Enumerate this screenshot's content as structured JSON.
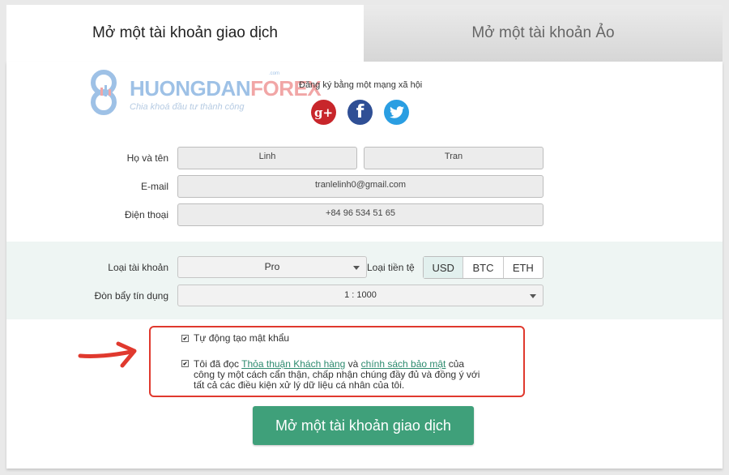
{
  "tabs": {
    "active": "Mở một tài khoản giao dịch",
    "inactive": "Mở một tài khoản Ảo"
  },
  "logo": {
    "name_part1": "HUONGDAN",
    "name_part2": "FOREX",
    "com": ".com",
    "tagline": "Chia khoá đầu tư thành công"
  },
  "social": {
    "label": "Đăng ký bằng một mạng xã hội",
    "icons": [
      "google-plus-icon",
      "facebook-icon",
      "twitter-icon"
    ],
    "google_glyph": "g+",
    "facebook_glyph": "f"
  },
  "form": {
    "name_label": "Họ và tên",
    "first_name": "Linh",
    "last_name": "Tran",
    "email_label": "E-mail",
    "email": "tranlelinh0@gmail.com",
    "phone_label": "Điện thoại",
    "phone": "+84 96 534 51 65",
    "account_type_label": "Loại tài khoản",
    "account_type": "Pro",
    "currency_label": "Loại tiền tệ",
    "currencies": [
      "USD",
      "BTC",
      "ETH"
    ],
    "selected_currency": "USD",
    "leverage_label": "Đòn bẩy tín dụng",
    "leverage": "1 : 1000"
  },
  "checks": {
    "auto_password": "Tự động tạo mật khẩu",
    "agree_prefix": "Tôi đã đọc",
    "agree_link1": "Thỏa thuận Khách hàng",
    "agree_and": "và",
    "agree_link2": "chính sách bảo mật",
    "agree_suffix_line1": "của",
    "agree_line2": "công ty một cách cẩn thận, chấp nhận chúng đầy đủ và đồng ý với",
    "agree_line3": "tất cả các điều kiện xử lý dữ liệu cá nhân của tôi."
  },
  "submit_label": "Mở một tài khoản giao dịch",
  "colors": {
    "accent_green": "#3fa07a",
    "highlight_red": "#e0392e",
    "link_green": "#2c8a6e"
  }
}
